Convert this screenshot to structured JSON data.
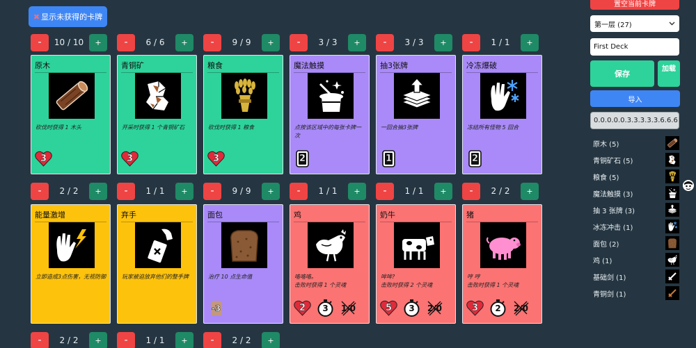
{
  "toolbar": {
    "toggle_icon": "✖",
    "toggle_label": "显示未获得的卡牌"
  },
  "sidebar": {
    "clear_label": "置空当前卡牌",
    "layer_value": "第一层 (27)",
    "deck_name_value": "First Deck",
    "save_label": "保存",
    "load_label": "加载",
    "import_label": "导入",
    "code_value": "0.0.0.0.0.3.3.3.3.3.6.6.6.6.",
    "deck_items": [
      {
        "label": "原木 (5)",
        "icon": "log-icon"
      },
      {
        "label": "青铜矿石 (5)",
        "icon": "ore-icon"
      },
      {
        "label": "粮食 (5)",
        "icon": "wheat-icon"
      },
      {
        "label": "魔法触摸 (3)",
        "icon": "magic-hat-icon"
      },
      {
        "label": "抽 3 张牌 (3)",
        "icon": "draw-cards-icon"
      },
      {
        "label": "冰冻冲击 (1)",
        "icon": "freeze-hand-icon"
      },
      {
        "label": "面包 (2)",
        "icon": "bread-icon"
      },
      {
        "label": "鸡 (1)",
        "icon": "chicken-icon"
      },
      {
        "label": "基础剑 (1)",
        "icon": "sword-icon"
      },
      {
        "label": "青铜剑 (1)",
        "icon": "bronze-sword-icon"
      }
    ]
  },
  "counters": [
    [
      "10 / 10",
      "6 / 6",
      "9 / 9",
      "3 / 3",
      "3 / 3",
      "1 / 1"
    ],
    [
      "2 / 2",
      "1 / 1",
      "9 / 9",
      "1 / 1",
      "1 / 1",
      "2 / 2"
    ],
    [
      "2 / 2",
      "1 / 1",
      "2 / 2"
    ]
  ],
  "counter_buttons": {
    "minus": "-",
    "plus": "+"
  },
  "cards": [
    {
      "name": "原木",
      "color": "#2dd39a",
      "icon": "log-icon",
      "desc": "砍伐时获得 1 木头",
      "stats": [
        {
          "kind": "heart",
          "value": "3"
        }
      ]
    },
    {
      "name": "青铜矿",
      "color": "#2dd39a",
      "icon": "ore-icon",
      "desc": "开采时获得 1 个青铜矿石",
      "stats": [
        {
          "kind": "heart",
          "value": "3"
        }
      ]
    },
    {
      "name": "粮食",
      "color": "#2dd39a",
      "icon": "wheat-icon",
      "desc": "砍伐时获得 1 粮食",
      "stats": [
        {
          "kind": "heart",
          "value": "3"
        }
      ]
    },
    {
      "name": "魔法触摸",
      "color": "#a98af8",
      "icon": "magic-hat-icon",
      "desc": "点按该区域中的每张卡牌一次",
      "stats": [
        {
          "kind": "cost",
          "value": "2"
        }
      ]
    },
    {
      "name": "抽3张牌",
      "color": "#a98af8",
      "icon": "draw-cards-icon",
      "desc": "一回合抽3张牌",
      "stats": [
        {
          "kind": "cost",
          "value": "1"
        }
      ]
    },
    {
      "name": "冷冻爆破",
      "color": "#a98af8",
      "icon": "freeze-hand-icon",
      "desc": "冻结所有怪物 5 回合",
      "stats": [
        {
          "kind": "cost",
          "value": "2"
        }
      ]
    },
    {
      "name": "能量激增",
      "color": "#fdc20c",
      "icon": "lightning-hand-icon",
      "desc": "立即造成3点伤害，无视防御",
      "stats": []
    },
    {
      "name": "弃手",
      "color": "#fdc20c",
      "icon": "discard-hand-icon",
      "desc": "玩家被迫放弃他们的整手牌",
      "stats": []
    },
    {
      "name": "面包",
      "color": "#a98af8",
      "icon": "bread-icon",
      "desc": "治疗 10 点生命值",
      "stats": [
        {
          "kind": "bread",
          "value": "-3"
        }
      ]
    },
    {
      "name": "鸡",
      "color": "#fb7373",
      "icon": "chicken-icon",
      "desc": "咯咯咯。\n击败时获得 1 个灵魂",
      "stats": [
        {
          "kind": "heart",
          "value": "2"
        },
        {
          "kind": "timer",
          "value": "3"
        },
        {
          "kind": "soul",
          "value": "1/0"
        }
      ]
    },
    {
      "name": "奶牛",
      "color": "#fb7373",
      "icon": "cow-icon",
      "desc": "哞哞?\n击败时获得 2 个灵魂",
      "stats": [
        {
          "kind": "heart",
          "value": "5"
        },
        {
          "kind": "timer",
          "value": "3"
        },
        {
          "kind": "soul",
          "value": "2/0"
        }
      ]
    },
    {
      "name": "猪",
      "color": "#fb7373",
      "icon": "pig-icon",
      "desc": "哼 哼\n击败时获得 1 个灵魂",
      "stats": [
        {
          "kind": "heart",
          "value": "3"
        },
        {
          "kind": "timer",
          "value": "2"
        },
        {
          "kind": "soul",
          "value": "2/0"
        }
      ]
    }
  ]
}
